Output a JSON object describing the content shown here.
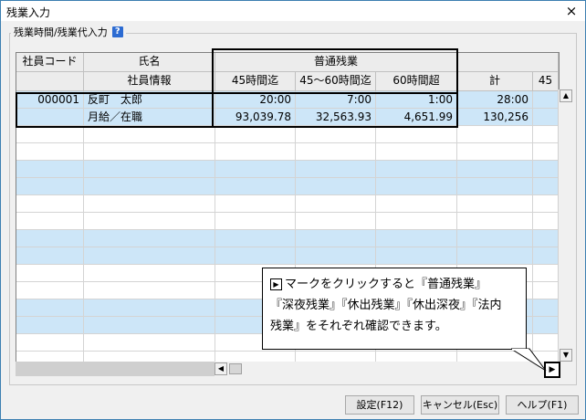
{
  "window": {
    "title": "残業入力",
    "close_glyph": "×"
  },
  "group": {
    "label": "残業時間/残業代入力",
    "help_glyph": "?"
  },
  "grid": {
    "header_top": {
      "employee_code": "社員コード",
      "name": "氏名",
      "regular_overtime": "普通残業"
    },
    "header_bottom": {
      "employee_info": "社員情報",
      "h45": "45時間迄",
      "h45_60": "45～60時間迄",
      "h60": "60時間超",
      "total": "計",
      "partial": "45"
    },
    "employee": {
      "code": "000001",
      "name": "反町　太郎",
      "info": "月給／在職",
      "hours": {
        "h45": "20:00",
        "h45_60": "7:00",
        "h60": "1:00",
        "total": "28:00"
      },
      "amounts": {
        "h45": "93,039.78",
        "h45_60": "32,563.93",
        "h60": "4,651.99",
        "total": "130,256"
      }
    }
  },
  "tooltip": {
    "line1": "マークをクリックすると『普通残業』",
    "line2": "『深夜残業』『休出残業』『休出深夜』『法内",
    "line3": "残業』をそれぞれ確認できます。",
    "marker_glyph": "▶"
  },
  "scroll": {
    "up": "▲",
    "down": "▼",
    "left": "◀",
    "right": "▶"
  },
  "buttons": {
    "settings": "設定(F12)",
    "cancel": "キャンセル(Esc)",
    "help": "ヘルプ(F1)"
  }
}
